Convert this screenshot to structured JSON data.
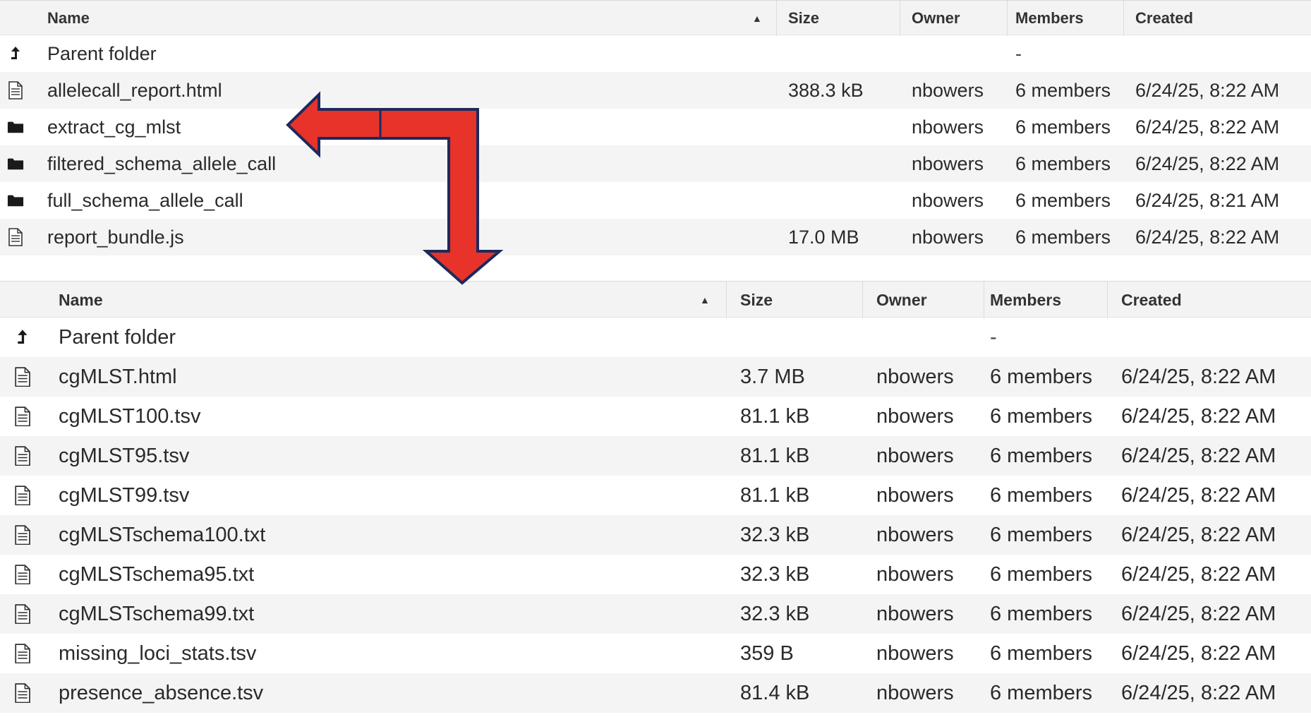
{
  "top_table": {
    "columns": {
      "name": "Name",
      "size": "Size",
      "owner": "Owner",
      "members": "Members",
      "created": "Created"
    },
    "parent_row": {
      "icon": "up-arrow-icon",
      "name": "Parent folder",
      "members": "-"
    },
    "rows": [
      {
        "icon": "file-icon",
        "name": "allelecall_report.html",
        "size": "388.3 kB",
        "owner": "nbowers",
        "members": "6 members",
        "created": "6/24/25, 8:22 AM"
      },
      {
        "icon": "folder-icon",
        "name": "extract_cg_mlst",
        "size": "",
        "owner": "nbowers",
        "members": "6 members",
        "created": "6/24/25, 8:22 AM"
      },
      {
        "icon": "folder-icon",
        "name": "filtered_schema_allele_call",
        "size": "",
        "owner": "nbowers",
        "members": "6 members",
        "created": "6/24/25, 8:22 AM"
      },
      {
        "icon": "folder-icon",
        "name": "full_schema_allele_call",
        "size": "",
        "owner": "nbowers",
        "members": "6 members",
        "created": "6/24/25, 8:21 AM"
      },
      {
        "icon": "file-icon",
        "name": "report_bundle.js",
        "size": "17.0 MB",
        "owner": "nbowers",
        "members": "6 members",
        "created": "6/24/25, 8:22 AM"
      }
    ]
  },
  "bottom_table": {
    "columns": {
      "name": "Name",
      "size": "Size",
      "owner": "Owner",
      "members": "Members",
      "created": "Created"
    },
    "parent_row": {
      "icon": "up-arrow-icon",
      "name": "Parent folder",
      "members": "-"
    },
    "rows": [
      {
        "icon": "file-icon",
        "name": "cgMLST.html",
        "size": "3.7 MB",
        "owner": "nbowers",
        "members": "6 members",
        "created": "6/24/25, 8:22 AM"
      },
      {
        "icon": "file-icon",
        "name": "cgMLST100.tsv",
        "size": "81.1 kB",
        "owner": "nbowers",
        "members": "6 members",
        "created": "6/24/25, 8:22 AM"
      },
      {
        "icon": "file-icon",
        "name": "cgMLST95.tsv",
        "size": "81.1 kB",
        "owner": "nbowers",
        "members": "6 members",
        "created": "6/24/25, 8:22 AM"
      },
      {
        "icon": "file-icon",
        "name": "cgMLST99.tsv",
        "size": "81.1 kB",
        "owner": "nbowers",
        "members": "6 members",
        "created": "6/24/25, 8:22 AM"
      },
      {
        "icon": "file-icon",
        "name": "cgMLSTschema100.txt",
        "size": "32.3 kB",
        "owner": "nbowers",
        "members": "6 members",
        "created": "6/24/25, 8:22 AM"
      },
      {
        "icon": "file-icon",
        "name": "cgMLSTschema95.txt",
        "size": "32.3 kB",
        "owner": "nbowers",
        "members": "6 members",
        "created": "6/24/25, 8:22 AM"
      },
      {
        "icon": "file-icon",
        "name": "cgMLSTschema99.txt",
        "size": "32.3 kB",
        "owner": "nbowers",
        "members": "6 members",
        "created": "6/24/25, 8:22 AM"
      },
      {
        "icon": "file-icon",
        "name": "missing_loci_stats.tsv",
        "size": "359 B",
        "owner": "nbowers",
        "members": "6 members",
        "created": "6/24/25, 8:22 AM"
      },
      {
        "icon": "file-icon",
        "name": "presence_absence.tsv",
        "size": "81.4 kB",
        "owner": "nbowers",
        "members": "6 members",
        "created": "6/24/25, 8:22 AM"
      }
    ]
  },
  "annotation": {
    "arrow_icon": "navigation-arrow-icon",
    "arrow_fill": "#e8332a",
    "arrow_stroke": "#1c2a5e"
  },
  "colors": {
    "row_alt": "#f4f4f4",
    "header_bg": "#f3f3f3"
  }
}
